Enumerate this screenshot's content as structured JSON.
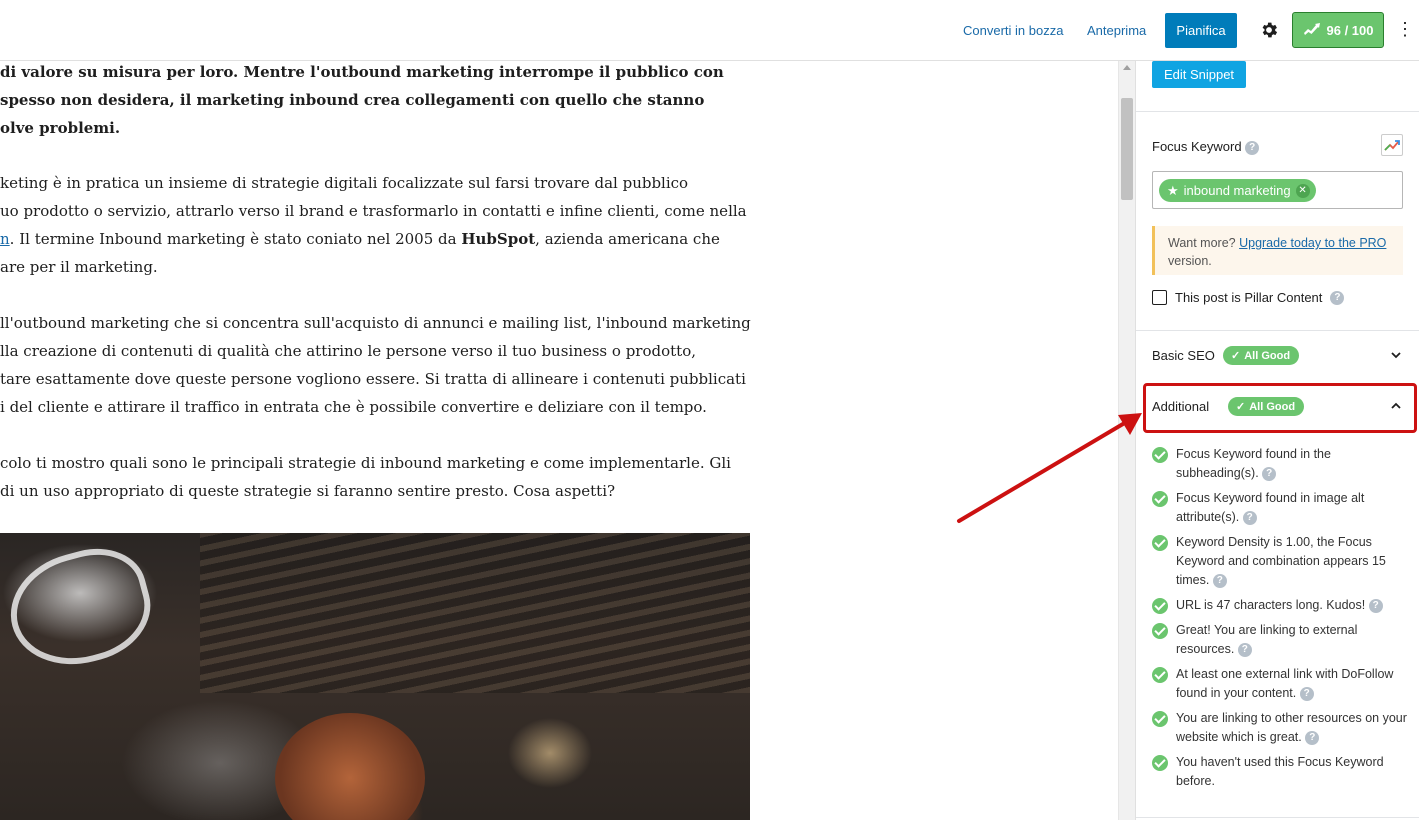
{
  "topbar": {
    "convert_to_draft": "Converti in bozza",
    "preview": "Anteprima",
    "schedule": "Pianifica",
    "score": "96 / 100",
    "settings_icon": "gear-icon",
    "more_icon": "vertical-ellipsis-icon"
  },
  "content": {
    "p1": [
      " di valore su misura per loro. Mentre l'outbound marketing interrompe il pubblico con",
      "spesso non desidera, il marketing inbound crea collegamenti con quello che stanno",
      "olve problemi."
    ],
    "p2": {
      "line1": "keting è in pratica un insieme di strategie digitali focalizzate sul farsi trovare dal pubblico",
      "line2": "uo prodotto o servizio, attrarlo verso il brand e trasformarlo in contatti e infine clienti, come nella",
      "line3_link": "n",
      "line3_before": ". Il termine Inbound marketing è stato coniato nel 2005 da ",
      "line3_bold": "HubSpot",
      "line3_after": ", azienda americana che",
      "line4": "are per il marketing."
    },
    "p3": [
      "ll'outbound marketing che si concentra sull'acquisto di annunci e mailing list, l'inbound marketing",
      "lla creazione di contenuti di qualità che attirino le persone verso il tuo business o prodotto,",
      "tare esattamente dove queste persone vogliono essere. Si tratta di allineare i contenuti pubblicati",
      "i del cliente e attirare il traffico in entrata che è possibile convertire e deliziare con il tempo."
    ],
    "p4": [
      "colo ti mostro quali sono le principali strategie di inbound marketing e come implementarle. Gli",
      "di un uso appropriato di queste strategie si faranno sentire presto. Cosa aspetti?"
    ]
  },
  "sidebar": {
    "edit_snippet": "Edit Snippet",
    "focus_keyword_label": "Focus Keyword",
    "keyword_tag": "inbound marketing",
    "promo_prefix": "Want more? ",
    "promo_link": "Upgrade today to the PRO",
    "promo_suffix": " version.",
    "pillar_label": "This post is Pillar Content",
    "basic_seo": {
      "title": "Basic SEO",
      "badge": "All Good",
      "expanded": false
    },
    "additional": {
      "title": "Additional",
      "badge": "All Good",
      "expanded": true
    },
    "tests": [
      "Focus Keyword found in the subheading(s).",
      "Focus Keyword found in image alt attribute(s).",
      "Keyword Density is 1.00, the Focus Keyword and combination appears 15 times.",
      "URL is 47 characters long. Kudos!",
      "Great! You are linking to external resources.",
      "At least one external link with DoFollow found in your content.",
      "You are linking to other resources on your website which is great.",
      "You haven't used this Focus Keyword before."
    ]
  },
  "colors": {
    "primary": "#007cba",
    "success": "#6bc56e",
    "annotation": "#cc1111"
  }
}
